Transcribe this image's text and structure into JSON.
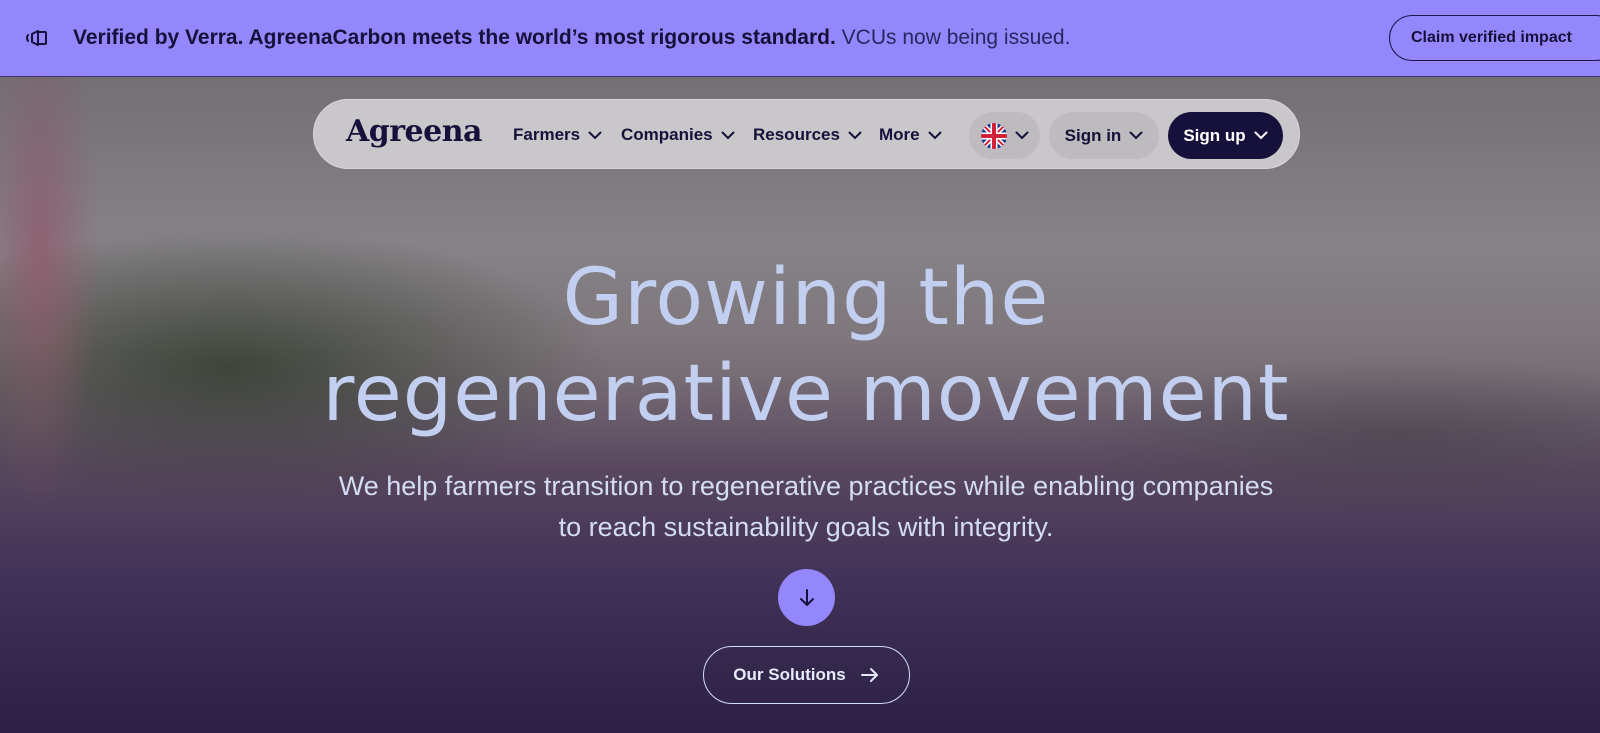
{
  "banner": {
    "icon": "megaphone-icon",
    "strong_text": "Verified by Verra. AgreenaCarbon meets the world’s most rigorous standard.",
    "light_text": " VCUs now being issued.",
    "cta_label": "Claim verified impact",
    "bg_color": "#9387fb"
  },
  "nav": {
    "logo": "Agreena",
    "items": [
      {
        "label": "Farmers"
      },
      {
        "label": "Companies"
      },
      {
        "label": "Resources"
      },
      {
        "label": "More"
      }
    ],
    "language_icon": "uk-flag-icon",
    "sign_in_label": "Sign in",
    "sign_up_label": "Sign up",
    "accent_color": "#15113a"
  },
  "hero": {
    "headline": "Growing the regenerative movement",
    "subtext": "We help farmers transition to regenerative practices while enabling companies to reach sustainability goals with integrity.",
    "scroll_icon": "arrow-down-icon",
    "cta_label": "Our Solutions",
    "cta_icon": "arrow-right-icon"
  }
}
